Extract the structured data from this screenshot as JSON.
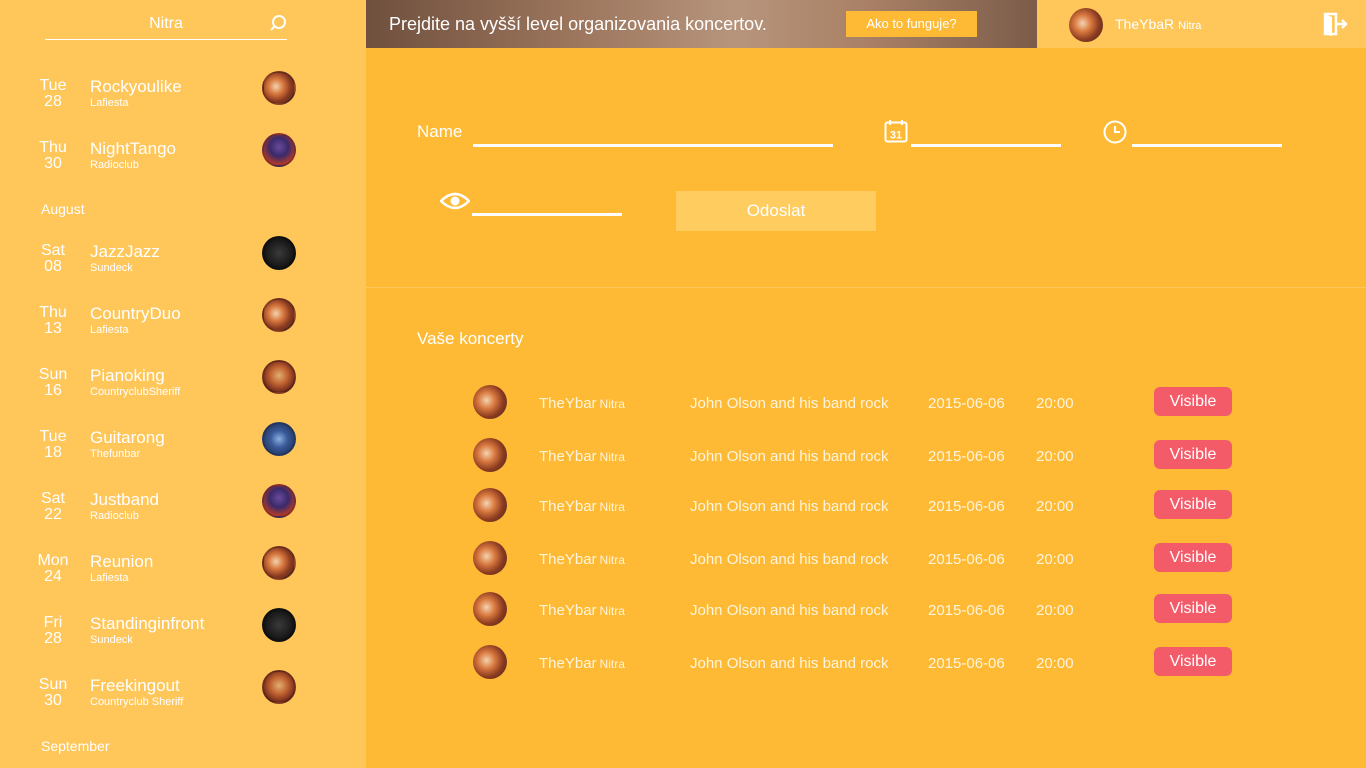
{
  "sidebar": {
    "search_value": "Nitra",
    "events_top": [
      {
        "day": "Tue",
        "date": "28",
        "title": "Rockyoulike",
        "venue": "Lafiesta",
        "avatar": "av-a"
      },
      {
        "day": "Thu",
        "date": "30",
        "title": "NightTango",
        "venue": "Radioclub",
        "avatar": "av-b"
      }
    ],
    "month_1": "August",
    "events_aug": [
      {
        "day": "Sat",
        "date": "08",
        "title": "JazzJazz",
        "venue": "Sundeck",
        "avatar": "av-c"
      },
      {
        "day": "Thu",
        "date": "13",
        "title": "CountryDuo",
        "venue": "Lafiesta",
        "avatar": "av-a"
      },
      {
        "day": "Sun",
        "date": "16",
        "title": "Pianoking",
        "venue": "CountryclubSheriff",
        "avatar": "av-d"
      },
      {
        "day": "Tue",
        "date": "18",
        "title": "Guitarong",
        "venue": "Thefunbar",
        "avatar": "av-e"
      },
      {
        "day": "Sat",
        "date": "22",
        "title": "Justband",
        "venue": "Radioclub",
        "avatar": "av-b"
      },
      {
        "day": "Mon",
        "date": "24",
        "title": "Reunion",
        "venue": "Lafiesta",
        "avatar": "av-a"
      },
      {
        "day": "Fri",
        "date": "28",
        "title": "Standinginfront",
        "venue": "Sundeck",
        "avatar": "av-c"
      },
      {
        "day": "Sun",
        "date": "30",
        "title": "Freekingout",
        "venue": "Countryclub Sheriff",
        "avatar": "av-d"
      }
    ],
    "month_2": "September"
  },
  "header": {
    "banner_text": "Prejdite na vyšší level organizovania koncertov.",
    "banner_button": "Ako to funguje?",
    "user_name": "TheYbaR",
    "user_city": "Nitra"
  },
  "form": {
    "name_label": "Name",
    "calendar_day": "31",
    "submit_label": "Odoslat"
  },
  "concerts": {
    "title": "Vaše koncerty",
    "rows": [
      {
        "venue": "TheYbar",
        "city": "Nitra",
        "name": "John Olson and his band rock",
        "date": "2015-06-06",
        "time": "20:00",
        "status": "Visible"
      },
      {
        "venue": "TheYbar",
        "city": "Nitra",
        "name": "John Olson and his band rock",
        "date": "2015-06-06",
        "time": "20:00",
        "status": "Visible"
      },
      {
        "venue": "TheYbar",
        "city": "Nitra",
        "name": "John Olson and his band rock",
        "date": "2015-06-06",
        "time": "20:00",
        "status": "Visible"
      },
      {
        "venue": "TheYbar",
        "city": "Nitra",
        "name": "John Olson and his band rock",
        "date": "2015-06-06",
        "time": "20:00",
        "status": "Visible"
      },
      {
        "venue": "TheYbar",
        "city": "Nitra",
        "name": "John Olson and his band rock",
        "date": "2015-06-06",
        "time": "20:00",
        "status": "Visible"
      },
      {
        "venue": "TheYbar",
        "city": "Nitra",
        "name": "John Olson and his band rock",
        "date": "2015-06-06",
        "time": "20:00",
        "status": "Visible"
      }
    ]
  }
}
